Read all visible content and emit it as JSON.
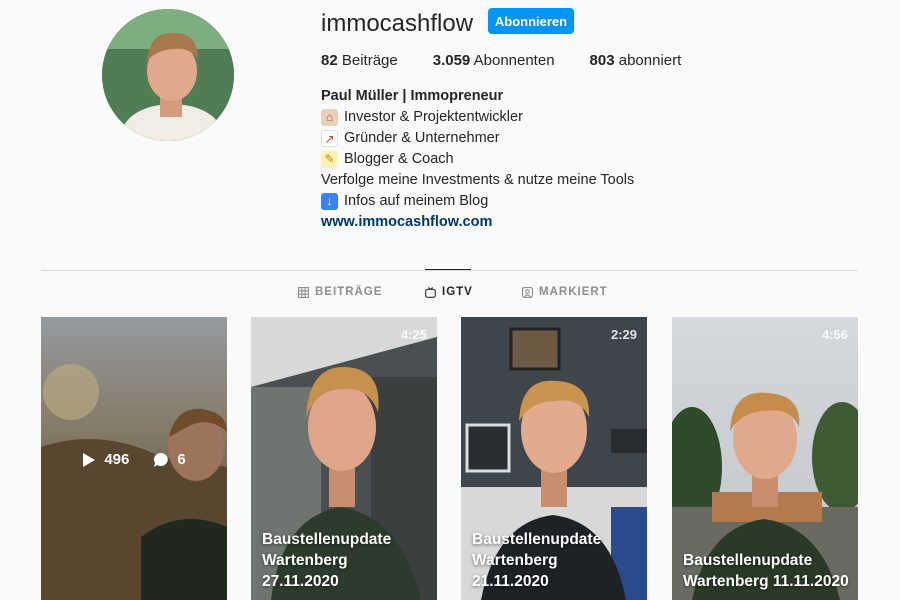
{
  "profile": {
    "username": "immocashflow",
    "follow_label": "Abonnieren",
    "stats": {
      "posts_count": "82",
      "posts_label": "Beiträge",
      "followers_count": "3.059",
      "followers_label": "Abonnenten",
      "following_count": "803",
      "following_label": "abonniert"
    },
    "bio": {
      "name": "Paul Müller | Immopreneur",
      "line1": "Investor & Projektentwickler",
      "line2": "Gründer & Unternehmer",
      "line3": "Blogger & Coach",
      "line4": "Verfolge meine Investments & nutze meine Tools",
      "line5": "Infos auf meinem Blog",
      "website": "www.immocashflow.com"
    }
  },
  "tabs": {
    "posts": "BEITRÄGE",
    "igtv": "IGTV",
    "tagged": "MARKIERT"
  },
  "videos": [
    {
      "views": "496",
      "comments": "6"
    },
    {
      "duration": "4:25",
      "title_line1": "Baustellenupdate",
      "title_line2": "Wartenberg",
      "title_line3": "27.11.2020"
    },
    {
      "duration": "2:29",
      "title_line1": "Baustellenupdate",
      "title_line2": "Wartenberg",
      "title_line3": "21.11.2020"
    },
    {
      "duration": "4:56",
      "title_line1": "Baustellenupdate",
      "title_line2": "Wartenberg 11.11.2020"
    }
  ],
  "colors": {
    "accent": "#0095f6",
    "link": "#00376b",
    "divider": "#dbdbdb"
  }
}
